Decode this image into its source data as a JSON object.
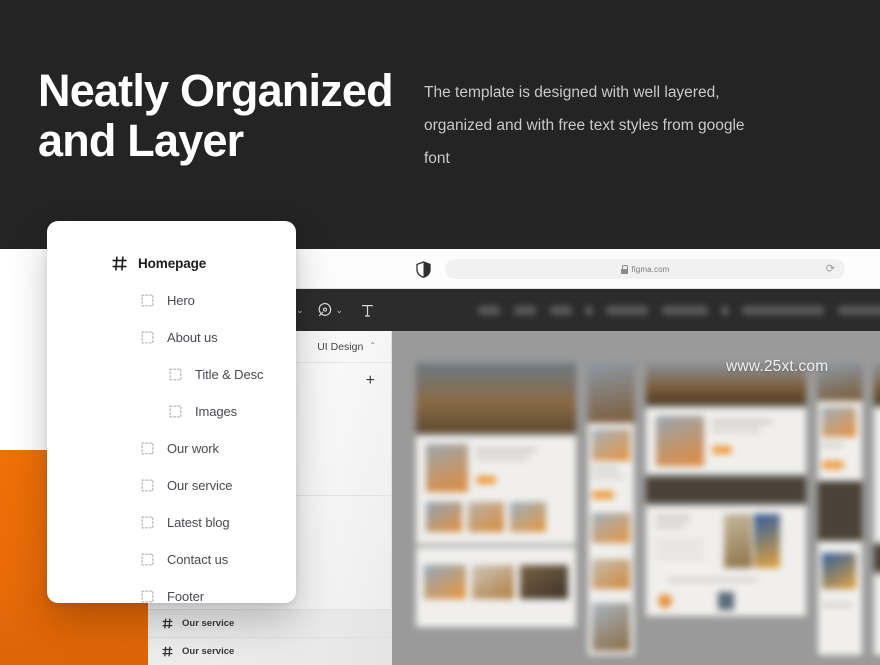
{
  "hero": {
    "title": "Neatly Organized and Layer",
    "description": "The template is designed with well layered, organized and with free text styles from google font"
  },
  "watermark": "www.25xt.com",
  "browser": {
    "url": "figma.com",
    "lock_icon": "lock-icon",
    "shield_icon": "shield-icon",
    "reload_icon": "reload-icon",
    "reload_glyph": "⟳"
  },
  "figma_toolbar": {
    "tools": [
      {
        "name": "frame-tool",
        "icon": "frame-icon",
        "has_chevron": true
      },
      {
        "name": "pen-tool",
        "icon": "pen-icon",
        "has_chevron": true
      },
      {
        "name": "text-tool",
        "icon": "text-icon",
        "glyph": "T",
        "has_chevron": false
      }
    ],
    "chevron_glyph": "⌄"
  },
  "left_panel": {
    "tab_label": "UI Design",
    "tab_chevron": "⌃",
    "add_label": "+",
    "rows": [
      {
        "icon": "frame-hash-icon",
        "label": "Our service"
      },
      {
        "icon": "frame-hash-icon",
        "label": "Our service"
      }
    ]
  },
  "layers_card": {
    "header": {
      "icon": "frame-hash-icon",
      "label": "Homepage"
    },
    "items": [
      {
        "label": "Hero",
        "indent": 0,
        "icon": "dotted-frame-icon"
      },
      {
        "label": "About us",
        "indent": 0,
        "icon": "dotted-frame-icon"
      },
      {
        "label": "Title & Desc",
        "indent": 1,
        "icon": "dotted-frame-icon"
      },
      {
        "label": "Images",
        "indent": 1,
        "icon": "dotted-frame-icon"
      },
      {
        "label": "Our work",
        "indent": 0,
        "icon": "dotted-frame-icon"
      },
      {
        "label": "Our service",
        "indent": 0,
        "icon": "dotted-frame-icon"
      },
      {
        "label": "Latest blog",
        "indent": 0,
        "icon": "dotted-frame-icon"
      },
      {
        "label": "Contact us",
        "indent": 0,
        "icon": "dotted-frame-icon"
      },
      {
        "label": "Footer",
        "indent": 0,
        "icon": "dotted-frame-icon"
      }
    ]
  },
  "colors": {
    "hero_bg": "#242424",
    "accent_orange": "#ea6c0a",
    "card_bg": "#ffffff",
    "toolbar_bg": "#2c2c2c",
    "canvas_bg": "#9a9a9a"
  }
}
